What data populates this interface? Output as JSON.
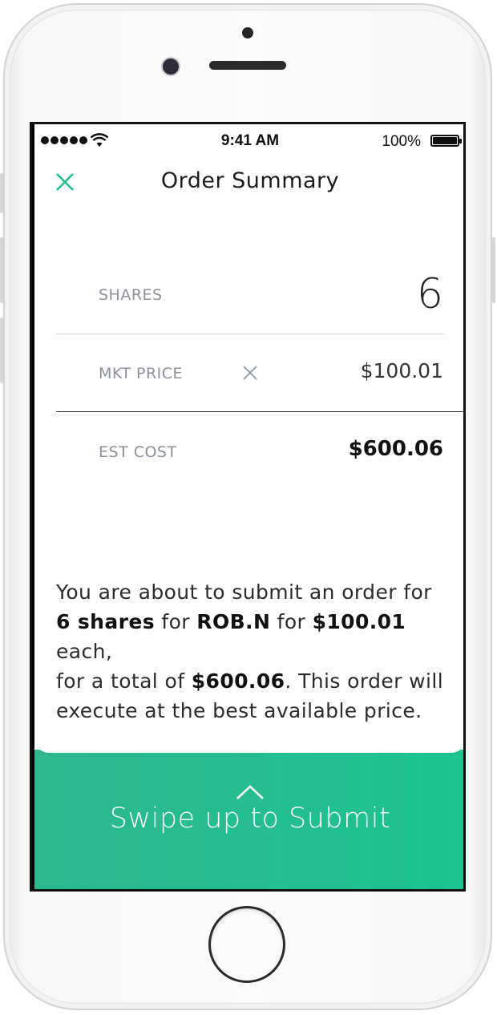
{
  "status_bar": {
    "time": "9:41 AM",
    "battery": "100%"
  },
  "header": {
    "title": "Order Summary",
    "close_icon": "close-icon"
  },
  "order": {
    "shares_label": "SHARES",
    "shares_value": "6",
    "mkt_price_label": "MKT PRICE",
    "mkt_price_value": "$100.01",
    "est_cost_label": "EST COST",
    "est_cost_value": "$600.06"
  },
  "description": {
    "line1": "You are about to submit an order for",
    "shares_bold": "6 shares",
    "for_text": " for ",
    "ticker": "ROB.N",
    "for_text2": " for ",
    "price_bold": "$100.01",
    "each_text": " each,",
    "total_prefix": "for a total of ",
    "total_bold": "$600.06",
    "total_suffix": ". This order will",
    "line4": "execute at the best available price."
  },
  "submit": {
    "label": "Swipe up to Submit",
    "icon": "chevron-up-icon"
  },
  "colors": {
    "accent": "#21bf90",
    "label_gray": "#8b9199"
  }
}
